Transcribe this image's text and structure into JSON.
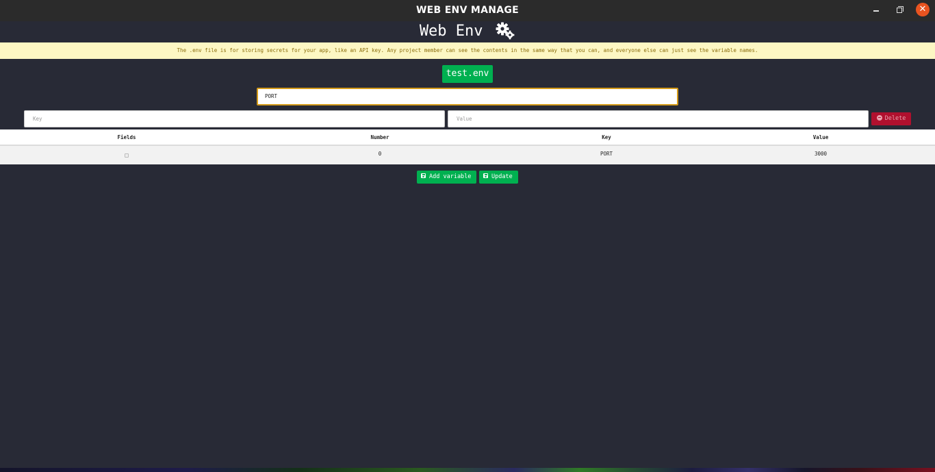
{
  "window": {
    "title": "WEB ENV MANAGE",
    "minimize_glyph": "",
    "maximize_glyph": "",
    "close_glyph": "✕"
  },
  "header": {
    "title": "Web Env",
    "icon": "gears-icon"
  },
  "notice": {
    "text": "The .env file is for storing secrets for your app, like an API key. Any project member can see the contents in the same way that you can, and everyone else can just see the variable names."
  },
  "file": {
    "name": "test.env"
  },
  "search": {
    "value": "PORT"
  },
  "editor": {
    "key_placeholder": "Key",
    "value_placeholder": "Value",
    "delete_label": "Delete"
  },
  "table": {
    "headers": [
      "Fields",
      "Number",
      "Key",
      "Value"
    ],
    "rows": [
      {
        "number": "0",
        "key": "PORT",
        "value": "3000"
      }
    ]
  },
  "actions": {
    "add_label": "Add variable",
    "update_label": "Update"
  },
  "colors": {
    "background": "#282a36",
    "accent_green": "#00b050",
    "danger_red": "#b0102e",
    "notice_bg": "#fdf7c3",
    "close_orange": "#e95420"
  }
}
